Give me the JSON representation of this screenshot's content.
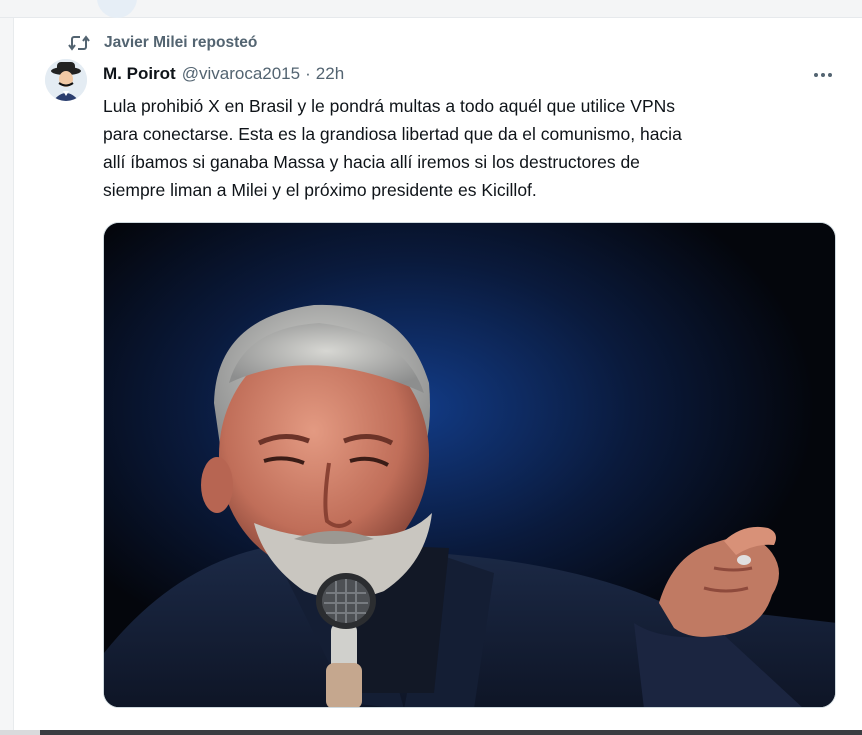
{
  "repost": {
    "label": "Javier Milei reposteó",
    "icon": "repost-icon"
  },
  "tweet": {
    "author": {
      "display_name": "M. Poirot",
      "handle": "@vivaroca2015",
      "avatar_icon": "avatar-cartoon-detective"
    },
    "separator": "·",
    "time": "22h",
    "more_icon": "more-dots-icon",
    "text": "Lula prohibió X en Brasil y le pondrá multas a todo aquél que utilice VPNs\npara conectarse. Esta es la grandiosa libertad que da el comunismo, hacia\nallí íbamos si ganaba Massa y hacia allí iremos si los destructores de\nsiempre liman a Milei y el próximo presidente es Kicillof.",
    "media": {
      "kind": "photo",
      "subject": "white-haired man speaking into microphone, pointing"
    }
  },
  "colors": {
    "text_primary": "#0f1419",
    "text_secondary": "#536471",
    "border": "#cfd9de"
  }
}
